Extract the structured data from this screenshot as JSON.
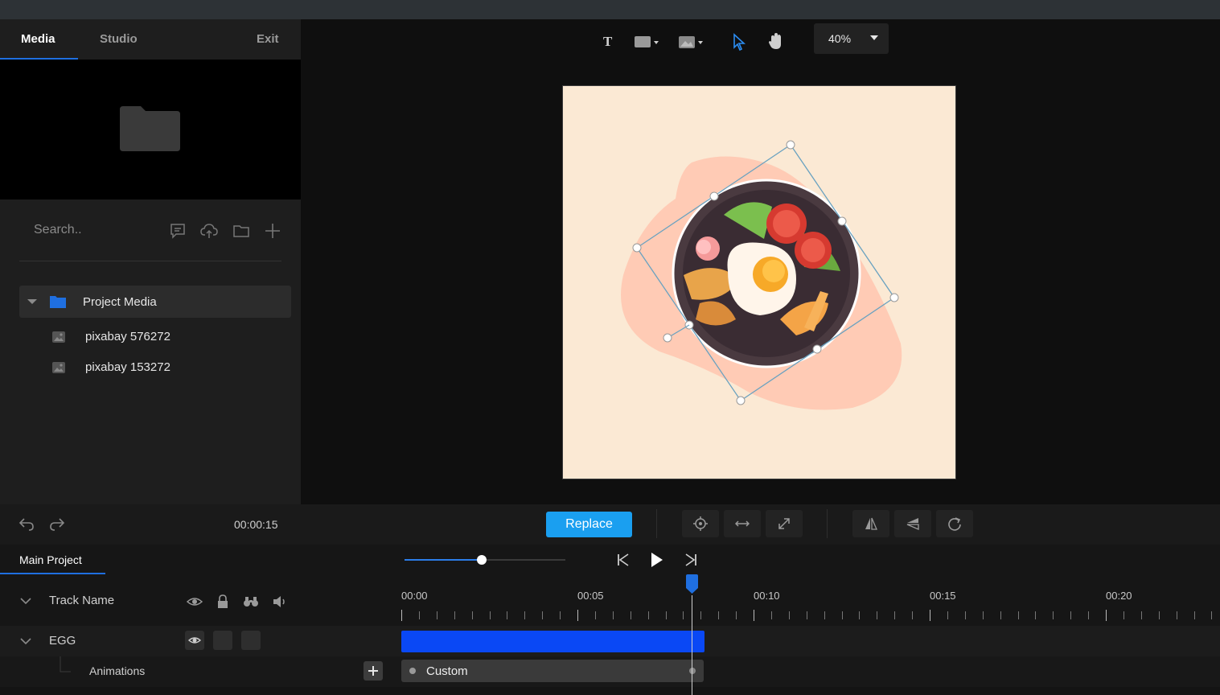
{
  "tabs": {
    "media": "Media",
    "studio": "Studio",
    "exit": "Exit"
  },
  "search": {
    "placeholder": "Search.."
  },
  "tree": {
    "root": "Project Media",
    "items": [
      {
        "label": "pixabay 576272"
      },
      {
        "label": "pixabay 153272"
      }
    ]
  },
  "canvas": {
    "zoom": "40%",
    "artboard_color": "#fbe9d4"
  },
  "bottom_toolbar": {
    "time": "00:00:15",
    "replace_label": "Replace"
  },
  "timeline": {
    "tab": "Main Project",
    "ruler": [
      "00:00",
      "00:05",
      "00:10",
      "00:15",
      "00:20"
    ],
    "tracks": {
      "header": "Track Name",
      "egg": "EGG",
      "animations": "Animations",
      "animation_clip": "Custom"
    }
  },
  "colors": {
    "accent": "#1a9ff0",
    "clip": "#0a48f5",
    "tab_underline": "#1f6fe0"
  }
}
